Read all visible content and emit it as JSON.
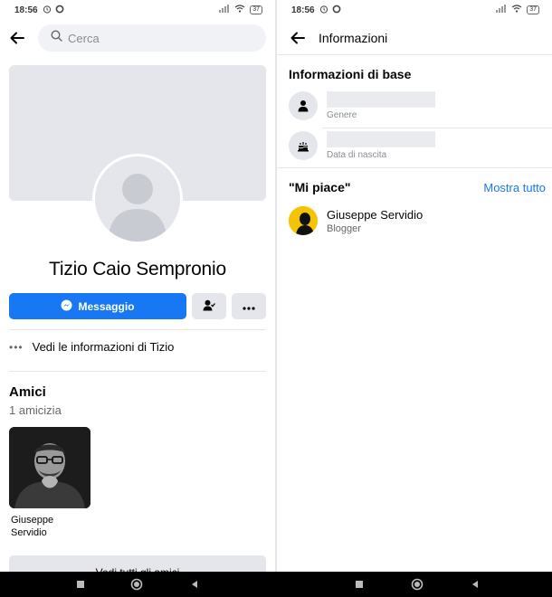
{
  "left": {
    "status_time": "18:56",
    "battery": "37",
    "search_placeholder": "Cerca",
    "profile_name": "Tizio Caio Sempronio",
    "message_label": "Messaggio",
    "info_link": "Vedi le informazioni di Tizio",
    "friends_title": "Amici",
    "friends_count": "1 amicizia",
    "friend_name_line1": "Giuseppe",
    "friend_name_line2": "Servidio",
    "see_all_friends": "Vedi tutti gli amici"
  },
  "right": {
    "status_time": "18:56",
    "battery": "37",
    "title": "Informazioni",
    "basic_info_title": "Informazioni di base",
    "gender_label": "Genere",
    "birthday_label": "Data di nascita",
    "likes_title": "\"Mi piace\"",
    "show_all": "Mostra tutto",
    "like_name": "Giuseppe Servidio",
    "like_category": "Blogger"
  },
  "colors": {
    "accent": "#1877f2",
    "grey_bg": "#e4e6eb",
    "text_secondary": "#65676b"
  },
  "icons": [
    "back-arrow-icon",
    "search-icon",
    "messenger-icon",
    "friend-check-icon",
    "more-icon",
    "person-icon",
    "birthday-cake-icon",
    "alarm-icon",
    "wifi-icon",
    "signal-icon",
    "nav-recents-icon",
    "nav-home-icon",
    "nav-back-icon"
  ]
}
